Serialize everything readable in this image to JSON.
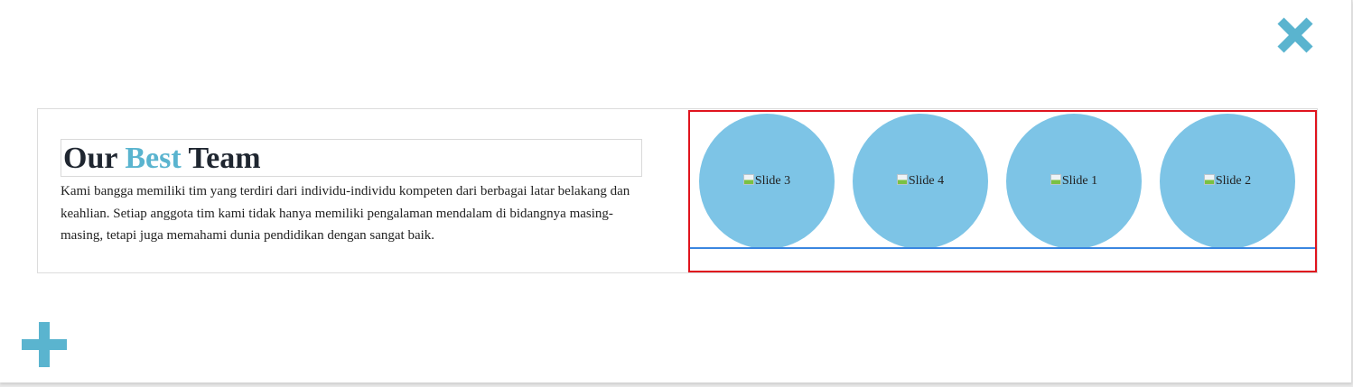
{
  "toolbar": {
    "close_icon": "close-x-icon",
    "add_icon": "plus-icon",
    "accent_color": "#5ab4cf"
  },
  "team_section": {
    "heading_part1": "Our ",
    "heading_accent": "Best",
    "heading_part2": " Team",
    "description": "Kami bangga memiliki tim yang terdiri dari individu-individu kompeten dari berbagai latar belakang dan keahlian. Setiap anggota tim kami tidak hanya memiliki pengalaman mendalam di bidangnya masing-masing, tetapi juga memahami dunia pendidikan dengan sangat baik."
  },
  "slider": {
    "slide_color": "#7dc4e6",
    "frame_color": "#e0141e",
    "track_line_color": "#3a86e0",
    "slides": [
      {
        "alt": "Slide 3"
      },
      {
        "alt": "Slide 4"
      },
      {
        "alt": "Slide 1"
      },
      {
        "alt": "Slide 2"
      }
    ]
  }
}
